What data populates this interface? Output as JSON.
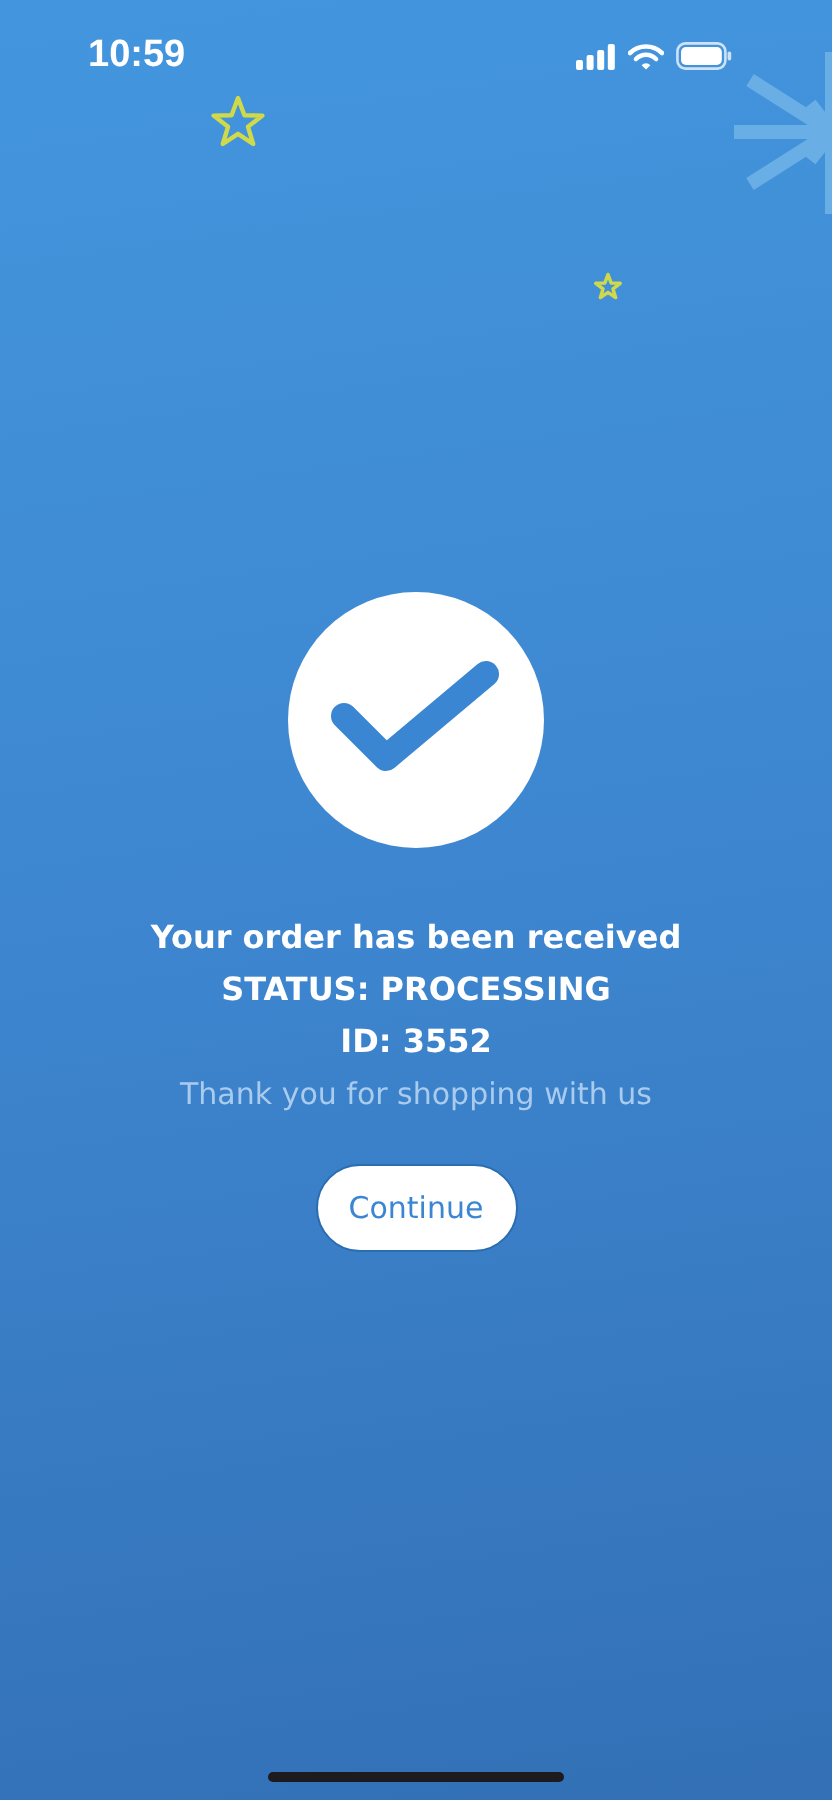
{
  "status_bar": {
    "time": "10:59"
  },
  "confirmation": {
    "title": "Your order has been received",
    "status": "STATUS: PROCESSING",
    "order_id": "ID: 3552",
    "message": "Thank you for shopping with us"
  },
  "buttons": [
    {
      "label": "Continue"
    }
  ]
}
